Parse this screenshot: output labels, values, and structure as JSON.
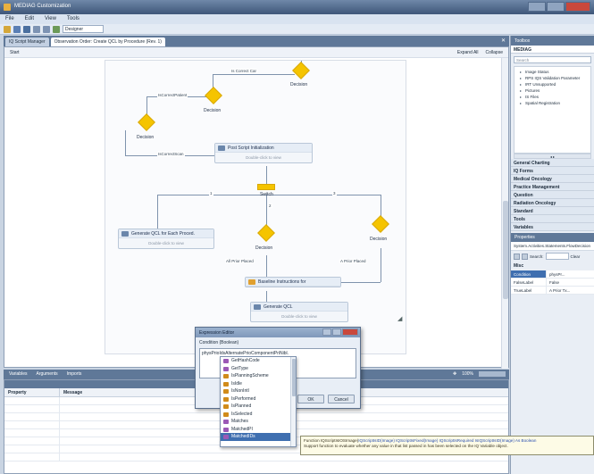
{
  "window": {
    "title": "MEDIAG Customization"
  },
  "menu": [
    "File",
    "Edit",
    "View",
    "Tools"
  ],
  "toolbar": {
    "dropdown_value": "Designer"
  },
  "tabs": [
    {
      "label": "IQ Script Manager"
    },
    {
      "label": "Observation Order: Create QCL by Procedure (Rev. 1)"
    }
  ],
  "designer": {
    "header_left": "Start",
    "expand_all": "Expand All",
    "collapse": "Collapse"
  },
  "workflow": {
    "decision_label": "Decision",
    "switch_label": "Switch",
    "activity_hint": "Double-click to view",
    "edges": {
      "is_correct_car": "Is Correct Car",
      "is_correct_patient": "IsCorrectPatient",
      "is_correct_scan": "IsCorrectScan",
      "case_1": "1",
      "case_2": "2",
      "case_3": "3",
      "all_prior_placed": "All Prior Placed",
      "a_prior_placed": "A Prior Placed"
    },
    "activities": {
      "post_script": "Post Script Initialization",
      "generate_qcl_start": "Generate QCL for Each Proced.",
      "baseline_instructions": "Baseline Instructions for",
      "generate_qcl": "Generate QCL"
    }
  },
  "lower_panel": {
    "tabs": [
      "Variables",
      "Arguments",
      "Imports"
    ],
    "zoom": "100%",
    "columns": [
      "Property",
      "Message"
    ]
  },
  "toolbox": {
    "title": "Toolbox",
    "group": "MEDIAG",
    "search_placeholder": "Search",
    "tree": [
      "Image Status",
      "RPS IQS Validation Parameter",
      "IRT Unsupported",
      "Pictures",
      "IS Files",
      "Spatial Registration"
    ],
    "categories": [
      "General Charting",
      "IQ Forms",
      "Medical Oncology",
      "Practice Management",
      "Question",
      "Radiation Oncology",
      "Standard",
      "Tools",
      "Variables"
    ]
  },
  "properties": {
    "title": "Properties",
    "selected_object": "System.Activities.Statements.FlowDecision",
    "search_label": "Search:",
    "clear_label": "Clear",
    "group": "Misc",
    "rows": [
      {
        "key": "Condition",
        "value": "physPr..."
      },
      {
        "key": "FalseLabel",
        "value": "False"
      },
      {
        "key": "TrueLabel",
        "value": "A Prior Tx..."
      }
    ]
  },
  "expression_editor": {
    "title": "Expression Editor",
    "condition_label": "Condition (Boolean)",
    "expression": "physPrioIdsAlternatePrioComponentPriNibl.",
    "ok_label": "OK",
    "cancel_label": "Cancel"
  },
  "intellisense": {
    "items": [
      "GetHashCode",
      "GetType",
      "IsPlanningScheme",
      "IsIdle",
      "IsNonIntl",
      "IsPerformed",
      "IsPlanned",
      "IsSelected",
      "Matches",
      "MatchedPI",
      "MatchedIDs"
    ],
    "selected_index": 10,
    "item_colors": [
      "#9b59b6",
      "#9b59b6",
      "#d18b1a",
      "#d18b1a",
      "#d18b1a",
      "#d18b1a",
      "#d18b1a",
      "#d18b1a",
      "#9b59b6",
      "#9b59b6",
      "#9b59b6"
    ]
  },
  "tooltip": {
    "signature_start": "Function IQScriptIsIOSImage(",
    "signature_mid": "IQScriptIsID(Image) IQScriptIsFixed(Image) IQScriptIsRequired IsIQScriptIsID(Image) As Boolean",
    "description": "Support function to evaluate whether any value in that list passed in has been selected on the IQ Variable object."
  },
  "colors": {
    "accent": "#5f7898",
    "selection": "#3f6fb0",
    "decision": "#f5c400"
  }
}
